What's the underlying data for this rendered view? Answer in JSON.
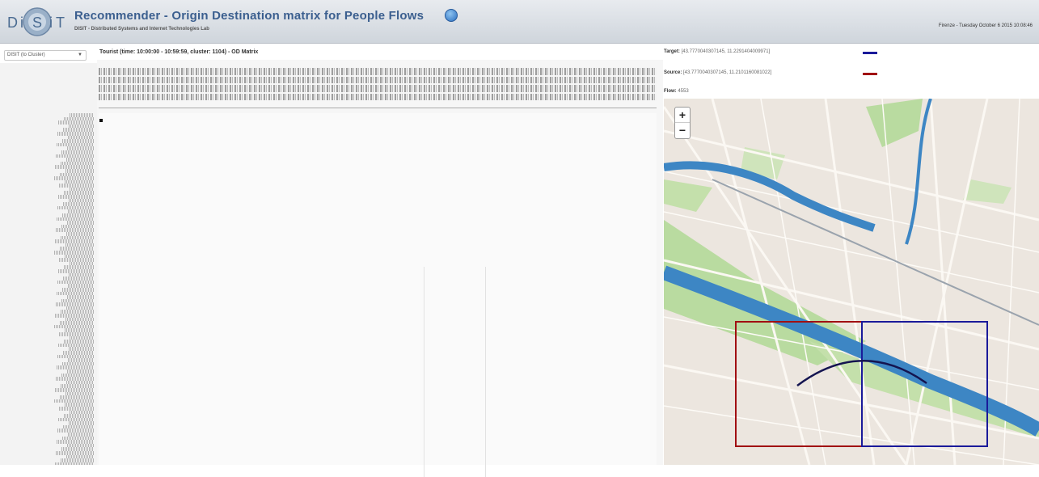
{
  "header": {
    "logo_text": "D⁠S⁠I⁠T",
    "title": "Recommender - Origin Destination matrix for People Flows",
    "subtitle": "DISIT - Distributed Systems and Internet Technologies Lab",
    "datetime": "Firenze - Tuesday October 6 2015 10:08:46"
  },
  "controls": {
    "cluster_select_value": "DISIT (to Cluster)"
  },
  "matrix": {
    "title": "Tourist (time: 10:00:00 - 10:59:59, cluster: 1104) - OD Matrix"
  },
  "info": {
    "target_label": "Target:",
    "target_value": "[43.7770040307145, 11.2291404009971]",
    "source_label": "Source:",
    "source_value": "[43.7770040307145, 11.2101160081022]",
    "flow_label": "Flow:",
    "flow_value": "4553"
  },
  "map": {
    "zoom_in": "+",
    "zoom_out": "−"
  },
  "colors": {
    "target": "#1a1a9a",
    "source": "#a10f12",
    "river": "#3d86c4",
    "park": "#b9dba0"
  }
}
